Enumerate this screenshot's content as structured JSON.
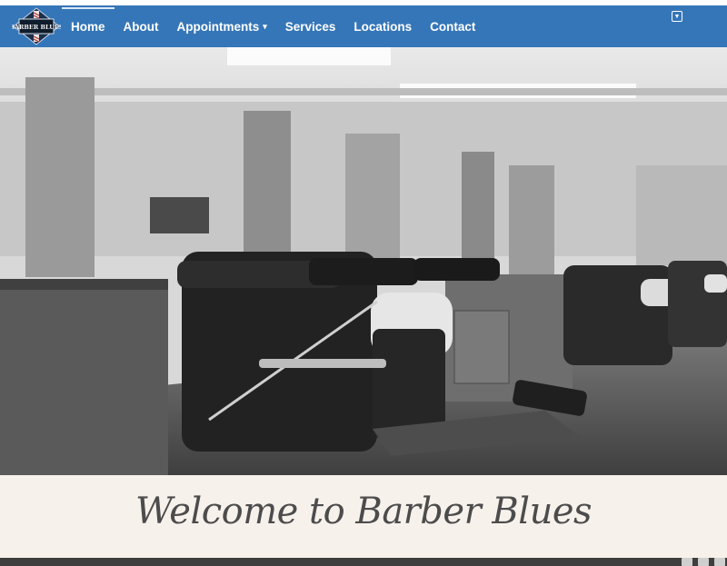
{
  "site": {
    "logo_text": "BARBER BLUES"
  },
  "nav": {
    "items": [
      {
        "label": "Home",
        "active": true
      },
      {
        "label": "About"
      },
      {
        "label": "Appointments",
        "dropdown": true
      },
      {
        "label": "Services"
      },
      {
        "label": "Locations"
      },
      {
        "label": "Contact"
      }
    ],
    "dropdown_icon": "chevron-down-icon"
  },
  "hero": {
    "image_description": "black-and-white photo of barber shop chairs"
  },
  "welcome": {
    "heading": "Welcome to Barber Blues"
  },
  "colors": {
    "navbar": "#3576b8",
    "page_background": "#f7f1ec",
    "heading": "#4c4c4c",
    "footer_bar": "#3e3e3e"
  }
}
